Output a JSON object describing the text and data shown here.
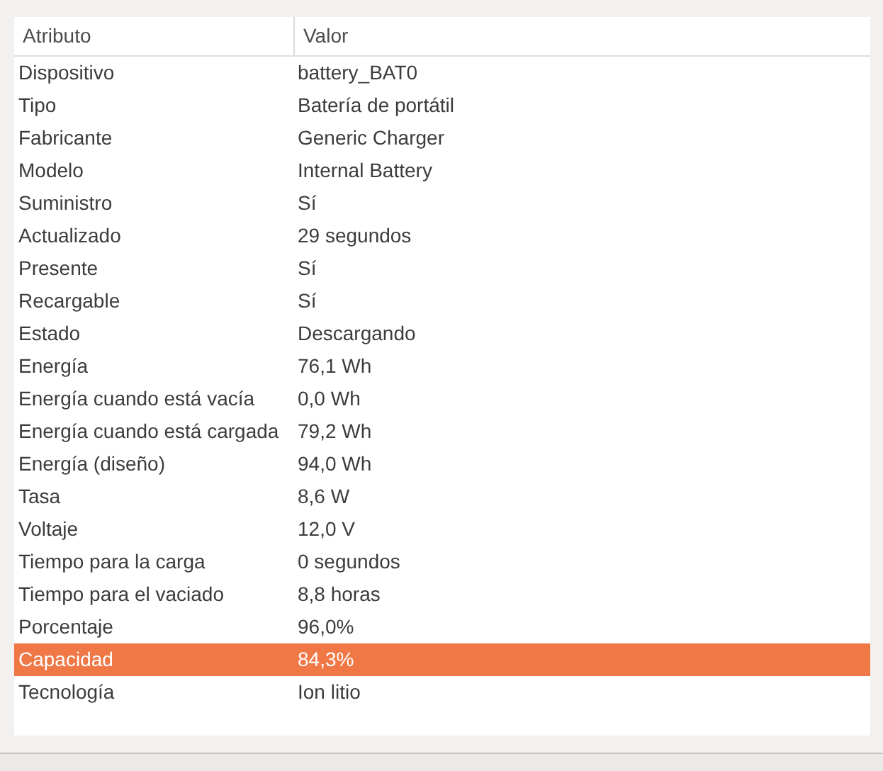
{
  "table": {
    "columns": [
      "Atributo",
      "Valor"
    ],
    "rows": [
      {
        "attribute": "Dispositivo",
        "value": "battery_BAT0",
        "selected": false
      },
      {
        "attribute": "Tipo",
        "value": "Batería de portátil",
        "selected": false
      },
      {
        "attribute": "Fabricante",
        "value": "Generic Charger",
        "selected": false
      },
      {
        "attribute": "Modelo",
        "value": "Internal Battery",
        "selected": false
      },
      {
        "attribute": "Suministro",
        "value": "Sí",
        "selected": false
      },
      {
        "attribute": "Actualizado",
        "value": "29 segundos",
        "selected": false
      },
      {
        "attribute": "Presente",
        "value": "Sí",
        "selected": false
      },
      {
        "attribute": "Recargable",
        "value": "Sí",
        "selected": false
      },
      {
        "attribute": "Estado",
        "value": "Descargando",
        "selected": false
      },
      {
        "attribute": "Energía",
        "value": "76,1 Wh",
        "selected": false
      },
      {
        "attribute": "Energía cuando está vacía",
        "value": "0,0 Wh",
        "selected": false
      },
      {
        "attribute": "Energía cuando está cargada",
        "value": "79,2 Wh",
        "selected": false
      },
      {
        "attribute": "Energía (diseño)",
        "value": "94,0 Wh",
        "selected": false
      },
      {
        "attribute": "Tasa",
        "value": "8,6 W",
        "selected": false
      },
      {
        "attribute": "Voltaje",
        "value": "12,0 V",
        "selected": false
      },
      {
        "attribute": "Tiempo para la carga",
        "value": "0 segundos",
        "selected": false
      },
      {
        "attribute": "Tiempo para el vaciado",
        "value": "8,8 horas",
        "selected": false
      },
      {
        "attribute": "Porcentaje",
        "value": "96,0%",
        "selected": false
      },
      {
        "attribute": "Capacidad",
        "value": "84,3%",
        "selected": true
      },
      {
        "attribute": "Tecnología",
        "value": "Ion litio",
        "selected": false
      }
    ]
  }
}
